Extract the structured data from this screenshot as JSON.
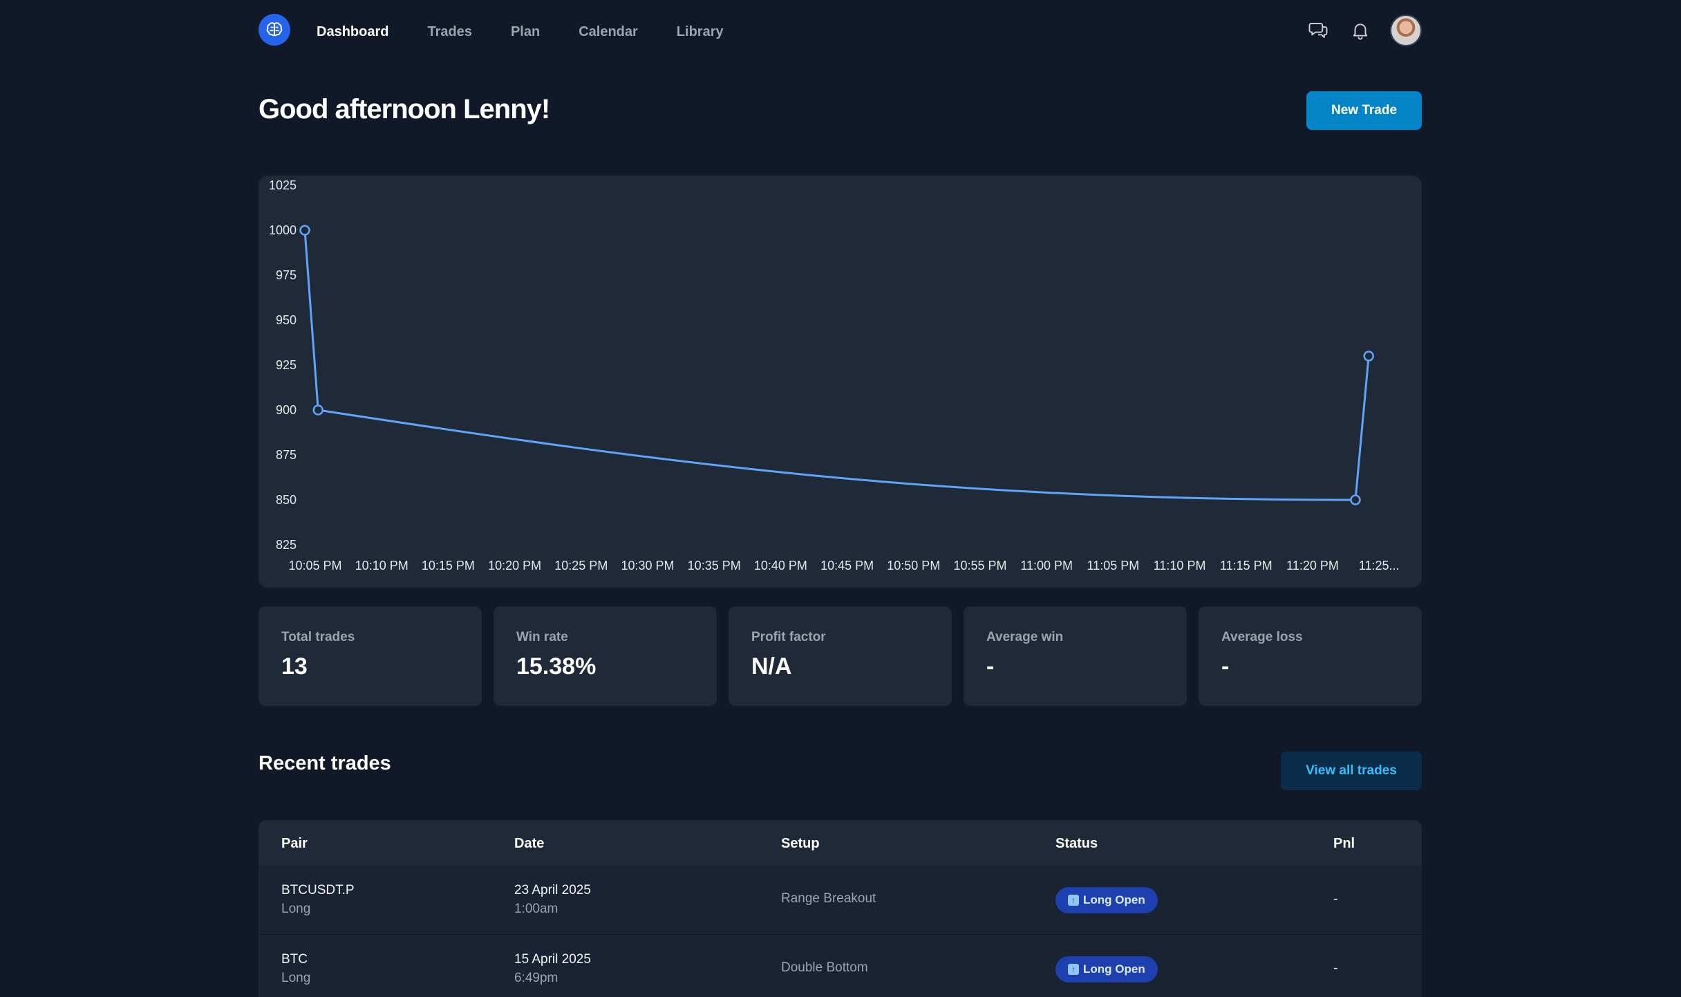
{
  "nav": {
    "items": [
      {
        "label": "Dashboard",
        "active": true
      },
      {
        "label": "Trades",
        "active": false
      },
      {
        "label": "Plan",
        "active": false
      },
      {
        "label": "Calendar",
        "active": false
      },
      {
        "label": "Library",
        "active": false
      }
    ],
    "icons": [
      "brain-logo-icon",
      "chat-icon",
      "bell-icon"
    ]
  },
  "header": {
    "greeting": "Good afternoon Lenny!",
    "new_trade_label": "New Trade"
  },
  "chart_data": {
    "type": "line",
    "x": [
      "10:05 PM",
      "10:10 PM",
      "10:15 PM",
      "10:20 PM",
      "10:25 PM",
      "10:30 PM",
      "10:35 PM",
      "10:40 PM",
      "10:45 PM",
      "10:50 PM",
      "10:55 PM",
      "11:00 PM",
      "11:05 PM",
      "11:10 PM",
      "11:15 PM",
      "11:20 PM",
      "11:25..."
    ],
    "y_ticks": [
      1025,
      1000,
      975,
      950,
      925,
      900,
      875,
      850,
      825
    ],
    "ylim": [
      825,
      1025
    ],
    "series": [
      {
        "color": "#60a5fa",
        "points": [
          {
            "x": "10:05 PM",
            "y": 1000
          },
          {
            "x": "10:06 PM",
            "y": 900
          },
          {
            "x": "11:24 PM",
            "y": 850
          },
          {
            "x": "11:25 PM",
            "y": 930
          }
        ]
      }
    ],
    "title": "",
    "xlabel": "",
    "ylabel": ""
  },
  "stats": [
    {
      "label": "Total trades",
      "value": "13"
    },
    {
      "label": "Win rate",
      "value": "15.38%"
    },
    {
      "label": "Profit factor",
      "value": "N/A"
    },
    {
      "label": "Average win",
      "value": "-"
    },
    {
      "label": "Average loss",
      "value": "-"
    }
  ],
  "recent": {
    "title": "Recent trades",
    "view_all_label": "View all trades",
    "columns": [
      "Pair",
      "Date",
      "Setup",
      "Status",
      "Pnl"
    ],
    "rows": [
      {
        "pair": "BTCUSDT.P",
        "side": "Long",
        "date": "23 April 2025",
        "time": "1:00am",
        "setup": "Range Breakout",
        "status": "Long Open",
        "pnl": "-"
      },
      {
        "pair": "BTC",
        "side": "Long",
        "date": "15 April 2025",
        "time": "6:49pm",
        "setup": "Double Bottom",
        "status": "Long Open",
        "pnl": "-"
      }
    ]
  },
  "colors": {
    "background": "#111827",
    "card": "#1f2937",
    "accent": "#0284c7",
    "line": "#60a5fa",
    "badge": "#1e40af"
  }
}
